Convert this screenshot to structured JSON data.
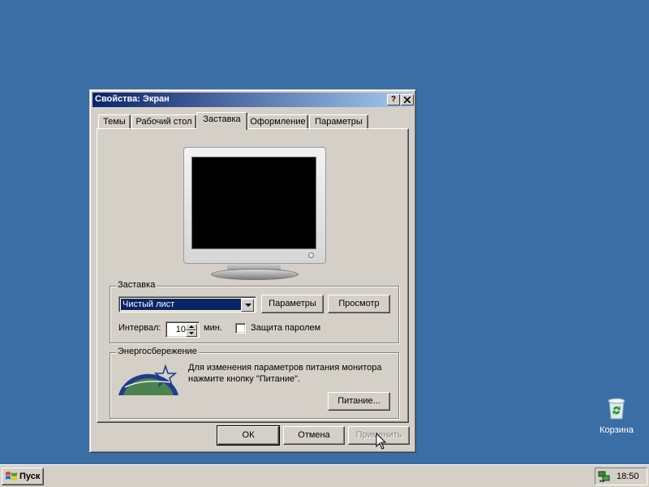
{
  "desktop": {
    "background": "#3a6ea5",
    "icons": [
      {
        "label": "Корзина",
        "icon": "recycle-bin-icon"
      }
    ]
  },
  "window": {
    "title": "Свойства: Экран",
    "help_button": "?",
    "close_button": "✕",
    "tabs": [
      {
        "label": "Темы",
        "active": false
      },
      {
        "label": "Рабочий стол",
        "active": false
      },
      {
        "label": "Заставка",
        "active": true
      },
      {
        "label": "Оформление",
        "active": false
      },
      {
        "label": "Параметры",
        "active": false
      }
    ],
    "screensaver": {
      "group_label": "Заставка",
      "selected": "Чистый лист",
      "settings_button": "Параметры",
      "preview_button": "Просмотр",
      "interval_label": "Интервал:",
      "interval_value": "10",
      "interval_unit": "мин.",
      "password_label": "Защита паролем",
      "password_checked": false
    },
    "power": {
      "group_label": "Энергосбережение",
      "description_line1": "Для изменения параметров питания монитора",
      "description_line2": "нажмите кнопку \"Питание\".",
      "power_button": "Питание...",
      "logo": "energy-star-logo"
    },
    "buttons": {
      "ok": "ОК",
      "cancel": "Отмена",
      "apply": "Применить"
    }
  },
  "taskbar": {
    "start_label": "Пуск",
    "clock": "18:50",
    "tray_icon": "network-icon"
  }
}
